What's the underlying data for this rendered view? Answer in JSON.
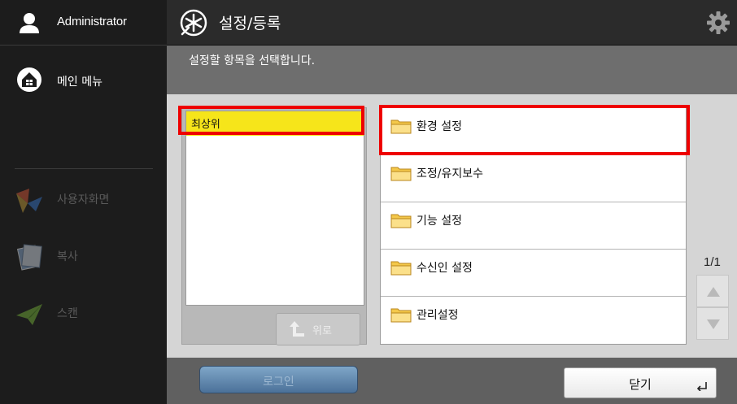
{
  "sidebar": {
    "user_label": "Administrator",
    "main_menu_label": "메인 메뉴",
    "functions": [
      {
        "label": "사용자화면",
        "icon": "custom-screen-icon"
      },
      {
        "label": "복사",
        "icon": "copy-icon"
      },
      {
        "label": "스캔",
        "icon": "scan-icon"
      }
    ]
  },
  "header": {
    "title": "설정/등록",
    "icon": "settings-register-icon",
    "gear_icon": "gear-icon"
  },
  "instruction": "설정할 항목을 선택합니다.",
  "tree": {
    "selected_item": "최상위",
    "up_button_label": "위로"
  },
  "list": {
    "items": [
      "환경 설정",
      "조정/유지보수",
      "기능 설정",
      "수신인 설정",
      "관리설정"
    ]
  },
  "pagination": {
    "page": "1/1"
  },
  "footer": {
    "login_label": "로그인",
    "close_label": "닫기"
  },
  "colors": {
    "highlight": "#ee0000",
    "selected_bg": "#f6e51a",
    "sidebar_bg": "#1c1c1c",
    "instruction_bg": "#6e6e6e"
  }
}
